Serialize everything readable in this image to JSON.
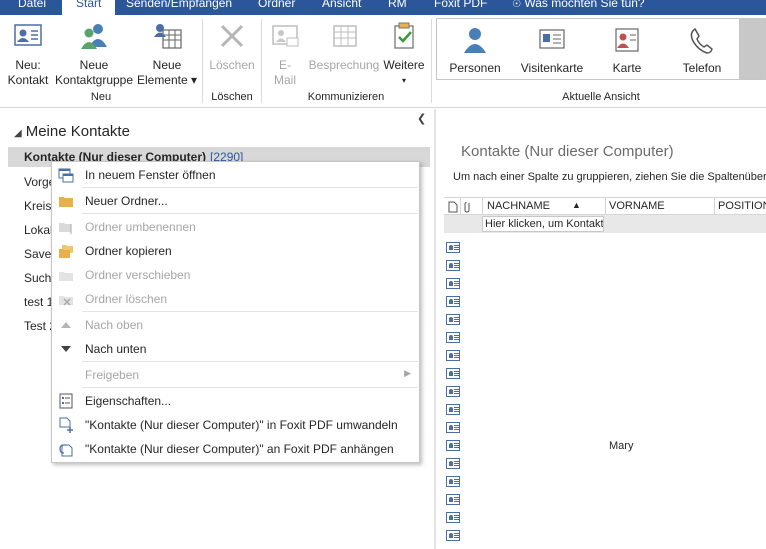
{
  "tabs": [
    {
      "label": "Datei",
      "active": false
    },
    {
      "label": "Start",
      "active": true
    },
    {
      "label": "Senden/Empfangen",
      "active": false
    },
    {
      "label": "Ordner",
      "active": false
    },
    {
      "label": "Ansicht",
      "active": false
    },
    {
      "label": "RM",
      "active": false
    },
    {
      "label": "Foxit PDF",
      "active": false
    },
    {
      "label": "Was möchten Sie tun?",
      "active": false
    }
  ],
  "ribbon": {
    "neu": {
      "group_label": "Neu",
      "new_contact": [
        "Neu:",
        "Kontakt"
      ],
      "new_contact_group": [
        "Neue",
        "Kontaktgruppe"
      ],
      "new_items": [
        "Neue",
        "Elemente ▾"
      ]
    },
    "loeschen": {
      "group_label": "Löschen",
      "delete": "Löschen"
    },
    "kommunizieren": {
      "group_label": "Kommunizieren",
      "email": [
        "E-",
        "Mail"
      ],
      "meeting": "Besprechung",
      "more": [
        "Weitere",
        "▾"
      ]
    },
    "aktuelle_ansicht": {
      "group_label": "Aktuelle Ansicht",
      "views": [
        "Personen",
        "Visitenkarte",
        "Karte",
        "Telefon"
      ]
    }
  },
  "nav": {
    "header": "Meine Kontakte",
    "selected": {
      "label": "Kontakte (Nur dieser Computer)",
      "count": "[2290]"
    },
    "items": [
      "Vorge",
      "Kreisr",
      "Lokal",
      "Saved",
      "Suche",
      "test 1",
      "Test 2"
    ]
  },
  "context_menu": {
    "items": [
      {
        "label": "In neuem Fenster öffnen",
        "disabled": false,
        "icon": "new-window-icon"
      },
      {
        "label": "Neuer Ordner...",
        "disabled": false,
        "icon": "folder-icon"
      },
      {
        "label": "Ordner umbenennen",
        "disabled": true,
        "icon": "rename-folder-icon"
      },
      {
        "label": "Ordner kopieren",
        "disabled": false,
        "icon": "copy-folder-icon"
      },
      {
        "label": "Ordner verschieben",
        "disabled": true,
        "icon": "move-folder-icon"
      },
      {
        "label": "Ordner löschen",
        "disabled": true,
        "icon": "delete-folder-icon"
      },
      {
        "label": "Nach oben",
        "disabled": true,
        "icon": "arrow-up-icon"
      },
      {
        "label": "Nach unten",
        "disabled": false,
        "icon": "arrow-down-icon"
      },
      {
        "label": "Freigeben",
        "disabled": true,
        "icon": "",
        "submenu": true
      },
      {
        "label": "Eigenschaften...",
        "disabled": false,
        "icon": "properties-icon"
      },
      {
        "label": "\"Kontakte (Nur dieser Computer)\" in Foxit PDF umwandeln",
        "disabled": false,
        "icon": "pdf-convert-icon"
      },
      {
        "label": "\"Kontakte (Nur dieser Computer)\" an Foxit PDF anhängen",
        "disabled": false,
        "icon": "pdf-attach-icon"
      }
    ]
  },
  "main": {
    "title": "Kontakte (Nur dieser Computer)",
    "group_hint": "Um nach einer Spalte zu gruppieren, ziehen Sie die Spaltenüberschrift hierher.",
    "columns": [
      "NACHNAME",
      "VORNAME",
      "POSITION"
    ],
    "sort_indicator": "▲",
    "new_row_placeholder": "Hier klicken, um Kontakt hinzuzufügen",
    "visible_name": "Mary"
  },
  "colors": {
    "accent": "#2b579a",
    "selection": "#d8d8d8"
  }
}
